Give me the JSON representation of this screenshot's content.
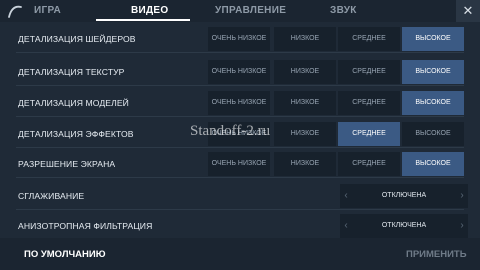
{
  "tabs": [
    {
      "label": "ИГРА",
      "active": false
    },
    {
      "label": "ВИДЕО",
      "active": true
    },
    {
      "label": "УПРАВЛЕНИЕ",
      "active": false
    },
    {
      "label": "ЗВУК",
      "active": false
    }
  ],
  "close_glyph": "✕",
  "levels": [
    "ОЧЕНЬ НИЗКОЕ",
    "НИЗКОЕ",
    "СРЕДНЕЕ",
    "ВЫСОКОЕ"
  ],
  "settings": [
    {
      "label": "ДЕТАЛИЗАЦИЯ ШЕЙДЕРОВ",
      "type": "levels",
      "selected": "ВЫСОКОЕ"
    },
    {
      "label": "ДЕТАЛИЗАЦИЯ ТЕКСТУР",
      "type": "levels",
      "selected": "ВЫСОКОЕ"
    },
    {
      "label": "ДЕТАЛИЗАЦИЯ МОДЕЛЕЙ",
      "type": "levels",
      "selected": "ВЫСОКОЕ"
    },
    {
      "label": "ДЕТАЛИЗАЦИЯ ЭФФЕКТОВ",
      "type": "levels",
      "selected": "СРЕДНЕЕ"
    },
    {
      "label": "РАЗРЕШЕНИЕ ЭКРАНА",
      "type": "levels",
      "selected": "ВЫСОКОЕ"
    },
    {
      "label": "СГЛАЖИВАНИЕ",
      "type": "cycler",
      "value": "ОТКЛЮЧЕНА"
    },
    {
      "label": "АНИЗОТРОПНАЯ ФИЛЬТРАЦИЯ",
      "type": "cycler",
      "value": "ОТКЛЮЧЕНА"
    }
  ],
  "cycler_arrows": {
    "left": "‹",
    "right": "›"
  },
  "footer": {
    "default_label": "ПО УМОЛЧАНИЮ",
    "apply_label": "ПРИМЕНИТЬ"
  },
  "watermark": "Standoff-2.ru",
  "colors": {
    "background": "#1f2a37",
    "option_bg": "#17212c",
    "selected": "#3b5a84"
  }
}
